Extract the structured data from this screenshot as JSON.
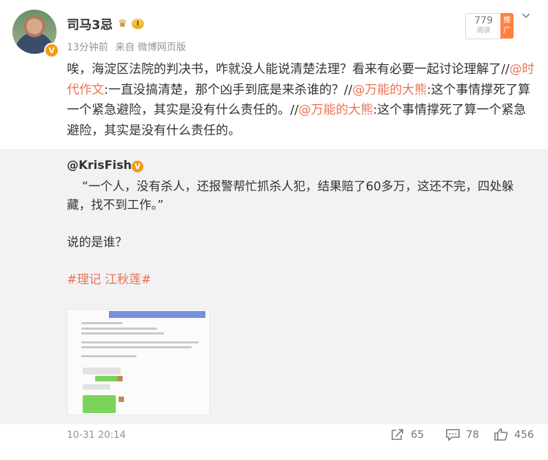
{
  "header": {
    "username": "司马3忌",
    "level": "I",
    "time_ago": "13分钟前",
    "source": "来自 微博网页版",
    "read_count": "779",
    "read_label": "阅读",
    "promote_label": "推广"
  },
  "post": {
    "text_1": "唉，海淀区法院的判决书，咋就没人能说清楚法理？看来有必要一起讨论理解了//",
    "mention_1": "@时代作文",
    "text_2": ":一直没搞清楚，那个凶手到底是来杀谁的？//",
    "mention_2": "@万能的大熊",
    "text_3": ":这个事情撑死了算一个紧急避险，其实是没有什么责任的。//",
    "mention_3": "@万能的大熊",
    "text_4": ":这个事情撑死了算一个紧急避险，其实是没有什么责任的。"
  },
  "repost": {
    "username": "@KrisFish",
    "quote": "“一个人，没有杀人，还报警帮忙抓杀人犯，结果赔了60多万，这还不完，四处躲藏，找不到工作。”",
    "question": "说的是谁？",
    "hashtag": "#理记 江秋莲#"
  },
  "footer": {
    "timestamp": "10-31 20:14",
    "forward_count": "65",
    "comment_count": "78",
    "like_count": "456"
  },
  "colors": {
    "link": "#eb7350",
    "repost_bg": "#f2f2f5",
    "promote": "#ff8140"
  }
}
